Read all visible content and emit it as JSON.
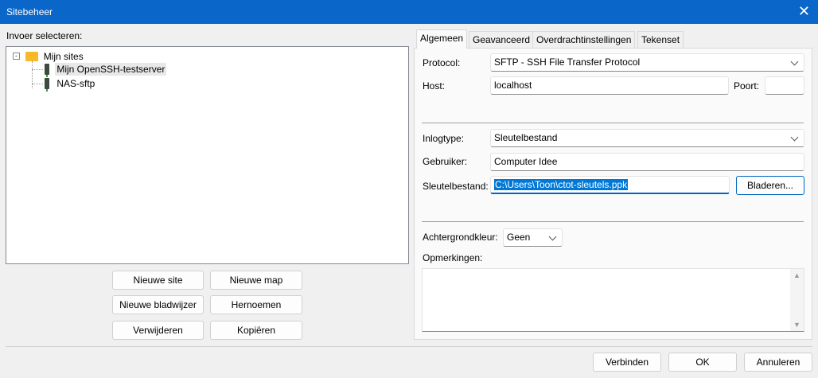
{
  "window": {
    "title": "Sitebeheer",
    "close_icon": "close-icon"
  },
  "left": {
    "label": "Invoer selecteren:",
    "tree": {
      "root": "Mijn sites",
      "children": [
        "Mijn OpenSSH-testserver",
        "NAS-sftp"
      ],
      "selected": "Mijn OpenSSH-testserver"
    },
    "buttons": {
      "new_site": "Nieuwe site",
      "new_folder": "Nieuwe map",
      "new_bookmark": "Nieuwe bladwijzer",
      "rename": "Hernoemen",
      "delete": "Verwijderen",
      "copy": "Kopiëren"
    }
  },
  "tabs": [
    "Algemeen",
    "Geavanceerd",
    "Overdrachtinstellingen",
    "Tekenset"
  ],
  "general": {
    "protocol_label": "Protocol:",
    "protocol_value": "SFTP - SSH File Transfer Protocol",
    "host_label": "Host:",
    "host_value": "localhost",
    "port_label": "Poort:",
    "port_value": "",
    "logontype_label": "Inlogtype:",
    "logontype_value": "Sleutelbestand",
    "user_label": "Gebruiker:",
    "user_value": "Computer Idee",
    "keyfile_label": "Sleutelbestand:",
    "keyfile_value": "C:\\Users\\Toon\\ctot-sleutels.ppk",
    "browse": "Bladeren...",
    "bgcolor_label": "Achtergrondkleur:",
    "bgcolor_value": "Geen",
    "comments_label": "Opmerkingen:",
    "comments_value": ""
  },
  "footer": {
    "connect": "Verbinden",
    "ok": "OK",
    "cancel": "Annuleren"
  }
}
